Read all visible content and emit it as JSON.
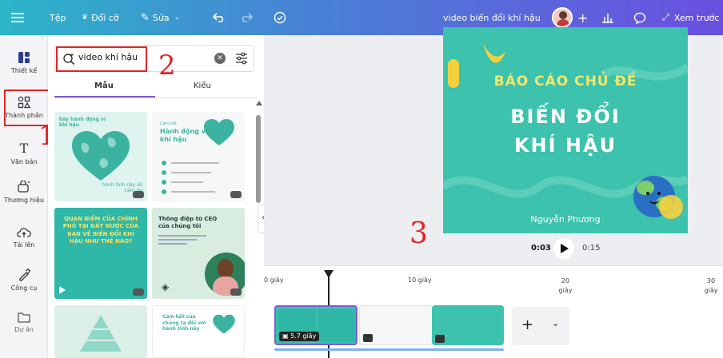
{
  "topbar": {
    "file_label": "Tệp",
    "resize_label": "Đổi cỡ",
    "edit_label": "Sửa",
    "doc_title": "video biến đổi khí hậu",
    "preview_label": "Xem trước"
  },
  "rail": {
    "items": [
      {
        "label": "Thiết kế"
      },
      {
        "label": "Thành phần"
      },
      {
        "label": "Văn bản"
      },
      {
        "label": "Thương hiệu"
      },
      {
        "label": "Tải lên"
      },
      {
        "label": "Công cụ"
      },
      {
        "label": "Dự án"
      }
    ]
  },
  "panel": {
    "search_value": "video khí hậu",
    "tabs": [
      "Mẫu",
      "Kiểu"
    ]
  },
  "templates": [
    {
      "title": "hãy hành động vì khí hậu",
      "subtitle": "hành tinh này sẽ cảm ơn"
    },
    {
      "title": "Hành động vì khí hậu",
      "subtitle": "Cam kết"
    },
    {
      "title": "QUAN ĐIỂM CỦA CHÍNH PHỦ TẠI ĐẤT NƯỚC CỦA BẠN VỀ BIẾN ĐỔI KHÍ HẬU NHƯ THẾ NÀO?"
    },
    {
      "title": "Thông điệp từ CEO của chúng tôi"
    },
    {
      "title": ""
    },
    {
      "title": "Cam kết của chúng ta đối với hành tinh này"
    }
  ],
  "slide": {
    "line1": "BÁO CÁO CHỦ ĐỀ",
    "line2": "BIẾN ĐỔI",
    "line3": "KHÍ HẬU",
    "author": "Nguyễn Phương"
  },
  "player": {
    "current": "0:03",
    "total": "0:15"
  },
  "timeline": {
    "ticks": [
      "0 giây",
      "10 giây",
      "20 giây",
      "30 giây"
    ],
    "clip_duration": "5.7 giây"
  },
  "annotations": [
    "1",
    "2",
    "3"
  ],
  "colors": {
    "accent": "#7b5bd8",
    "slide_bg": "#3cc2ad",
    "slide_yellow": "#f4d03f",
    "annotation_red": "#e02424"
  }
}
